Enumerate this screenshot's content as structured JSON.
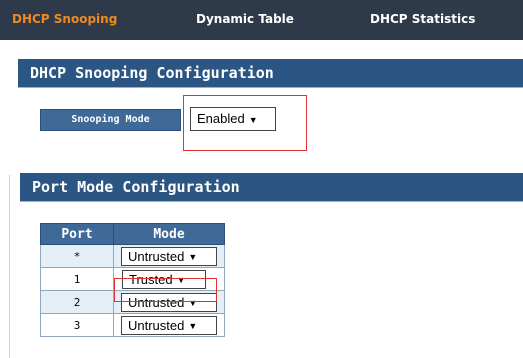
{
  "tabs": [
    {
      "label": "DHCP Snooping",
      "active": true
    },
    {
      "label": "Dynamic Table",
      "active": false
    },
    {
      "label": "DHCP Statistics",
      "active": false
    }
  ],
  "snooping_config": {
    "title": "DHCP Snooping Configuration",
    "mode_label": "Snooping Mode",
    "mode_value": "Enabled"
  },
  "port_config": {
    "title": "Port Mode Configuration",
    "headers": {
      "port": "Port",
      "mode": "Mode"
    },
    "rows": [
      {
        "port": "*",
        "mode": "Untrusted"
      },
      {
        "port": "1",
        "mode": "Trusted"
      },
      {
        "port": "2",
        "mode": "Untrusted"
      },
      {
        "port": "3",
        "mode": "Untrusted"
      }
    ]
  },
  "colors": {
    "active_tab": "#f08a1e",
    "header_bar": "#2b5583",
    "highlight": "#e23232"
  },
  "icons": {
    "dropdown": "caret-down-icon"
  }
}
